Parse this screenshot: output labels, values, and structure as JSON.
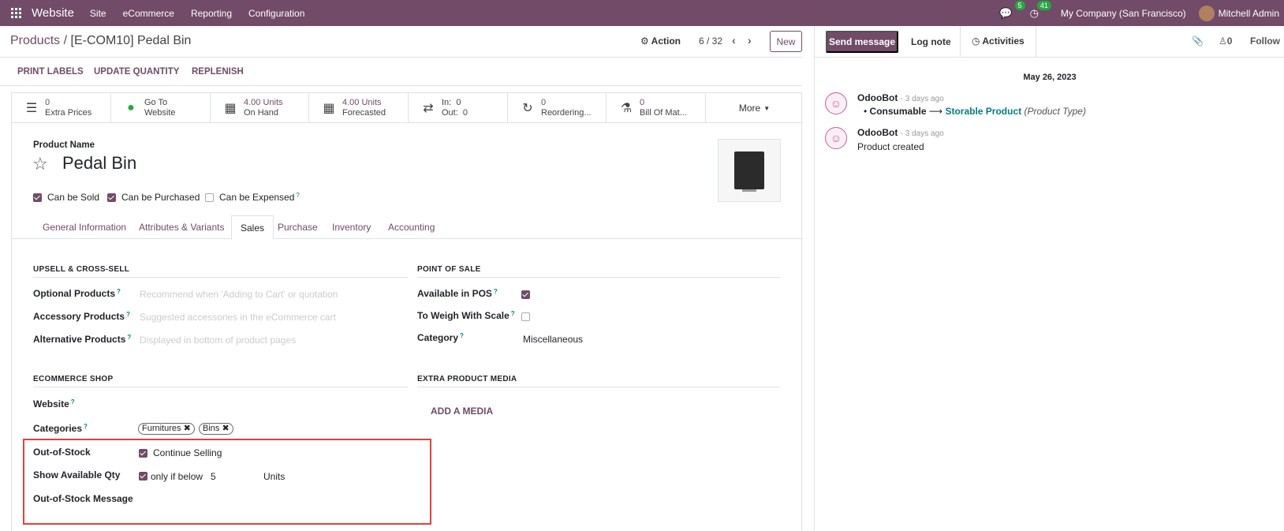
{
  "topbar": {
    "app_name": "Website",
    "menus": [
      "Site",
      "eCommerce",
      "Reporting",
      "Configuration"
    ],
    "messages_count": "5",
    "activities_count": "41",
    "company": "My Company (San Francisco)",
    "user": "Mitchell Admin"
  },
  "control": {
    "breadcrumb_parent": "Products",
    "breadcrumb_sep": "/",
    "breadcrumb_current": "[E-COM10] Pedal Bin",
    "action_label": "Action",
    "pager": "6 / 32",
    "new_label": "New"
  },
  "status_buttons": [
    "PRINT LABELS",
    "UPDATE QUANTITY",
    "REPLENISH"
  ],
  "smart_buttons": [
    {
      "icon": "list-icon",
      "value": "0",
      "label": "Extra Prices"
    },
    {
      "icon": "globe-icon",
      "value": "Go To",
      "label": "Website"
    },
    {
      "icon": "cubes-icon",
      "value": "4.00 Units",
      "label": "On Hand"
    },
    {
      "icon": "cubes-icon",
      "value": "4.00 Units",
      "label": "Forecasted"
    },
    {
      "icon": "exchange-icon",
      "value": "In:  0",
      "label": "Out:  0"
    },
    {
      "icon": "refresh-icon",
      "value": "0",
      "label": "Reordering..."
    },
    {
      "icon": "flask-icon",
      "value": "0",
      "label": "Bill Of Mat..."
    },
    {
      "icon": "caret-down-icon",
      "value": "",
      "label": "More"
    }
  ],
  "product": {
    "name_label": "Product Name",
    "name": "Pedal Bin",
    "can_be_sold": "Can be Sold",
    "can_be_purchased": "Can be Purchased",
    "can_be_expensed": "Can be Expensed",
    "can_be_sold_checked": true,
    "can_be_purchased_checked": true,
    "can_be_expensed_checked": false
  },
  "tabs": [
    "General Information",
    "Attributes & Variants",
    "Sales",
    "Purchase",
    "Inventory",
    "Accounting"
  ],
  "active_tab": "Sales",
  "upsell": {
    "title": "UPSELL & CROSS-SELL",
    "optional_label": "Optional Products",
    "optional_placeholder": "Recommend when 'Adding to Cart' or quotation",
    "accessory_label": "Accessory Products",
    "accessory_placeholder": "Suggested accessories in the eCommerce cart",
    "alternative_label": "Alternative Products",
    "alternative_placeholder": "Displayed in bottom of product pages"
  },
  "pos": {
    "title": "POINT OF SALE",
    "available_label": "Available in POS",
    "available_checked": true,
    "weigh_label": "To Weigh With Scale",
    "weigh_checked": false,
    "category_label": "Category",
    "category_value": "Miscellaneous"
  },
  "ecommerce": {
    "title": "ECOMMERCE SHOP",
    "website_label": "Website",
    "categories_label": "Categories",
    "categories": [
      "Furnitures",
      "Bins"
    ],
    "out_of_stock_label": "Out-of-Stock",
    "continue_selling": "Continue Selling",
    "continue_selling_checked": true,
    "show_qty_label": "Show Available Qty",
    "show_qty_checked": true,
    "only_if_below": "only if below",
    "threshold": "5",
    "units": "Units",
    "message_label": "Out-of-Stock Message"
  },
  "media": {
    "title": "EXTRA PRODUCT MEDIA",
    "add_label": "ADD A MEDIA"
  },
  "chatter": {
    "send_message": "Send message",
    "log_note": "Log note",
    "activities": "Activities",
    "followers_count": "0",
    "follow": "Follow",
    "date": "May 26, 2023",
    "messages": [
      {
        "author": "OdooBot",
        "time": "- 3 days ago",
        "old": "Consumable",
        "new": "Storable Product",
        "field": "(Product Type)"
      },
      {
        "author": "OdooBot",
        "time": "- 3 days ago",
        "body": "Product created"
      }
    ]
  },
  "colors": {
    "brand": "#714b67",
    "highlight": "#e0413b",
    "badge": "#28a745"
  }
}
